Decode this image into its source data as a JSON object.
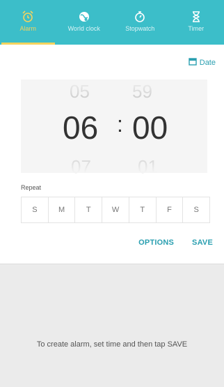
{
  "tabs": [
    {
      "label": "Alarm",
      "icon": "alarm-clock-icon",
      "active": true
    },
    {
      "label": "World clock",
      "icon": "globe-icon",
      "active": false
    },
    {
      "label": "Stopwatch",
      "icon": "stopwatch-icon",
      "active": false
    },
    {
      "label": "Timer",
      "icon": "hourglass-icon",
      "active": false
    }
  ],
  "date": {
    "label": "Date",
    "icon": "calendar-icon"
  },
  "picker": {
    "hour_prev": "05",
    "hour": "06",
    "hour_next": "07",
    "minute_prev": "59",
    "minute": "00",
    "minute_next": "01",
    "separator": ":"
  },
  "repeat": {
    "label": "Repeat",
    "days": [
      "S",
      "M",
      "T",
      "W",
      "T",
      "F",
      "S"
    ]
  },
  "actions": {
    "options": "OPTIONS",
    "save": "SAVE"
  },
  "hint": "To create alarm, set time and then tap SAVE",
  "colors": {
    "tabbar": "#3cbec9",
    "active_tab": "#f4d35e",
    "accent": "#2a9fb0"
  }
}
